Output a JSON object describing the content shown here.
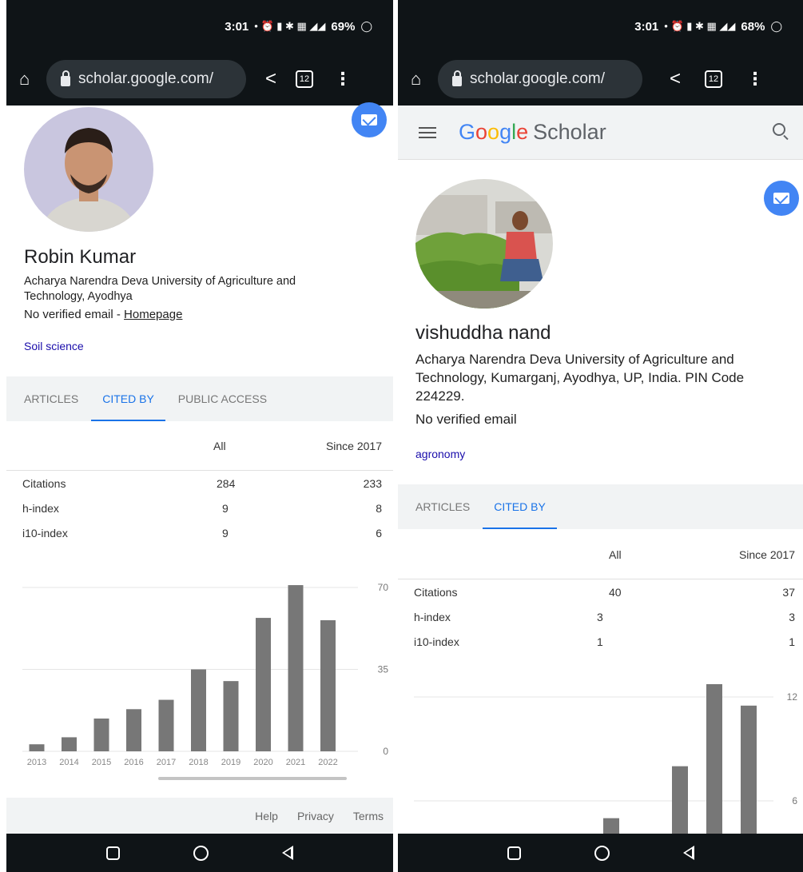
{
  "left": {
    "status": {
      "time": "3:01",
      "icons": "• ⏰ ▮ ✱ ▦ ◢◢",
      "battery": "69%"
    },
    "url": "scholar.google.com/",
    "tabs_count": "12",
    "profile": {
      "name": "Robin Kumar",
      "affiliation": "Acharya Narendra Deva University of Agriculture and Technology, Ayodhya",
      "email": "No verified email - ",
      "homepage": "Homepage",
      "interest": "Soil science"
    },
    "tabs": [
      "ARTICLES",
      "CITED BY",
      "PUBLIC ACCESS"
    ],
    "stats": {
      "col_all": "All",
      "col_since": "Since 2017",
      "rows": [
        {
          "label": "Citations",
          "all": "284",
          "since": "233"
        },
        {
          "label": "h-index",
          "all": "9",
          "since": "8"
        },
        {
          "label": "i10-index",
          "all": "9",
          "since": "6"
        }
      ]
    },
    "footer": {
      "help": "Help",
      "privacy": "Privacy",
      "terms": "Terms"
    }
  },
  "right": {
    "status": {
      "time": "3:01",
      "icons": "• ⏰ ▮ ✱ ▦ ◢◢",
      "battery": "68%"
    },
    "url": "scholar.google.com/",
    "tabs_count": "12",
    "header": {
      "logo_letters": [
        "G",
        "o",
        "o",
        "g",
        "l",
        "e"
      ],
      "logo_suffix": "Scholar"
    },
    "profile": {
      "name": "vishuddha nand",
      "affiliation": "Acharya Narendra Deva University of Agriculture and Technology, Kumarganj, Ayodhya, UP, India. PIN Code 224229.",
      "email": "No verified email",
      "interest": "agronomy"
    },
    "tabs": [
      "ARTICLES",
      "CITED BY"
    ],
    "stats": {
      "col_all": "All",
      "col_since": "Since 2017",
      "rows": [
        {
          "label": "Citations",
          "all": "40",
          "since": "37"
        },
        {
          "label": "h-index",
          "all": "3",
          "since": "3"
        },
        {
          "label": "i10-index",
          "all": "1",
          "since": "1"
        }
      ]
    }
  },
  "chart_data": [
    {
      "type": "bar",
      "categories": [
        "2013",
        "2014",
        "2015",
        "2016",
        "2017",
        "2018",
        "2019",
        "2020",
        "2021",
        "2022"
      ],
      "values": [
        3,
        6,
        14,
        18,
        22,
        35,
        30,
        57,
        71,
        56
      ],
      "ylim": [
        0,
        70
      ],
      "yticks": [
        "0",
        "35",
        "70"
      ],
      "title": "",
      "xlabel": "",
      "ylabel": "",
      "bar_color": "#777777"
    },
    {
      "type": "bar",
      "categories": [],
      "values": [
        0,
        0,
        0,
        0,
        0,
        5,
        2,
        8,
        13,
        11.5
      ],
      "ylim": [
        0,
        12
      ],
      "yticks": [
        "6",
        "12"
      ],
      "title": "",
      "xlabel": "",
      "ylabel": "",
      "bar_color": "#777777"
    }
  ]
}
